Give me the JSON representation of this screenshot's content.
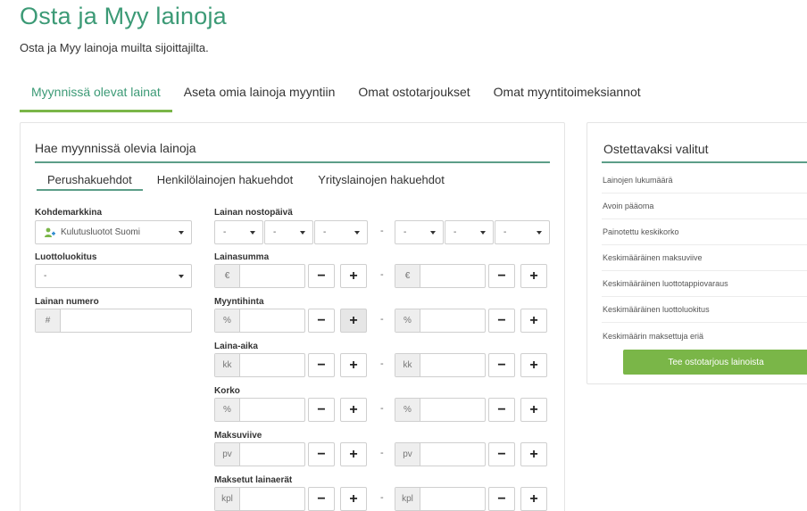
{
  "page": {
    "title": "Osta ja Myy lainoja",
    "subtitle": "Osta ja Myy lainoja muilta sijoittajilta."
  },
  "main_tabs": [
    {
      "label": "Myynnissä olevat lainat",
      "active": true
    },
    {
      "label": "Aseta omia lainoja myyntiin",
      "active": false
    },
    {
      "label": "Omat ostotarjoukset",
      "active": false
    },
    {
      "label": "Omat myyntitoimeksiannot",
      "active": false
    }
  ],
  "search_panel": {
    "title": "Hae myynnissä olevia lainoja",
    "sub_tabs": [
      {
        "label": "Perushakuehdot",
        "active": true
      },
      {
        "label": "Henkilölainojen hakuehdot",
        "active": false
      },
      {
        "label": "Yrityslainojen hakuehdot",
        "active": false
      }
    ],
    "target_market": {
      "label": "Kohdemarkkina",
      "value": "Kulutusluotot Suomi",
      "icon": "people-plus-icon"
    },
    "credit_rating": {
      "label": "Luottoluokitus",
      "value": "-"
    },
    "loan_number": {
      "label": "Lainan numero",
      "prefix": "#"
    },
    "withdrawal_date": {
      "label": "Lainan nostopäivä",
      "from": [
        "-",
        "-",
        "-"
      ],
      "to": [
        "-",
        "-",
        "-"
      ],
      "separator": "-"
    },
    "ranges": [
      {
        "label": "Lainasumma",
        "unit": "€"
      },
      {
        "label": "Myyntihinta",
        "unit": "%"
      },
      {
        "label": "Laina-aika",
        "unit": "kk"
      },
      {
        "label": "Korko",
        "unit": "%"
      },
      {
        "label": "Maksuviive",
        "unit": "pv"
      },
      {
        "label": "Maksetut lainaerät",
        "unit": "kpl"
      }
    ],
    "minus_symbol": "−",
    "plus_symbol": "+",
    "range_separator": "-"
  },
  "selected_panel": {
    "title": "Ostettavaksi valitut",
    "stats": [
      "Lainojen lukumäärä",
      "Avoin pääoma",
      "Painotettu keskikorko",
      "Keskimääräinen maksuviive",
      "Keskimääräinen luottotappiovaraus",
      "Keskimääräinen luottoluokitus",
      "Keskimäärin maksettuja eriä"
    ],
    "button_label": "Tee ostotarjous lainoista"
  },
  "colors": {
    "brand_green": "#3c9a76",
    "accent_green": "#7ab648",
    "rule_teal": "#5c9e88"
  }
}
